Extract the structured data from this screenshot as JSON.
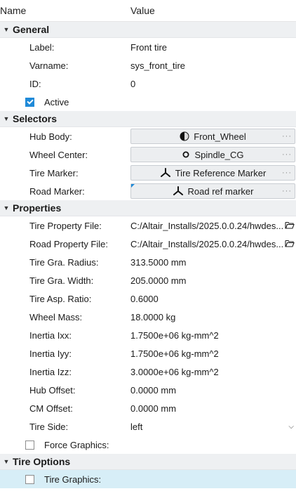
{
  "header": {
    "name_label": "Name",
    "value_label": "Value"
  },
  "sections": {
    "general": "General",
    "selectors": "Selectors",
    "properties": "Properties",
    "tire_options": "Tire Options"
  },
  "general": {
    "label": {
      "name": "Label:",
      "value": "Front tire"
    },
    "varname": {
      "name": "Varname:",
      "value": "sys_front_tire"
    },
    "id": {
      "name": "ID:",
      "value": "0"
    },
    "active": {
      "name": "Active",
      "checked": true
    }
  },
  "selectors": {
    "hub_body": {
      "name": "Hub Body:",
      "value": "Front_Wheel",
      "icon": "body-sphere-icon"
    },
    "wheel_center": {
      "name": "Wheel Center:",
      "value": "Spindle_CG",
      "icon": "point-icon"
    },
    "tire_marker": {
      "name": "Tire Marker:",
      "value": "Tire Reference Marker",
      "icon": "marker-icon"
    },
    "road_marker": {
      "name": "Road Marker:",
      "value": "Road ref marker",
      "icon": "marker-icon"
    }
  },
  "properties": {
    "tire_property_file": {
      "name": "Tire Property File:",
      "value": "C:/Altair_Installs/2025.0.0.24/hwdes..."
    },
    "road_property_file": {
      "name": "Road Property File:",
      "value": "C:/Altair_Installs/2025.0.0.24/hwdes..."
    },
    "tire_radius": {
      "name": "Tire Gra. Radius:",
      "value": "313.5000 mm"
    },
    "tire_width": {
      "name": "Tire Gra. Width:",
      "value": "205.0000 mm"
    },
    "tire_aspect": {
      "name": "Tire Asp. Ratio:",
      "value": "0.6000"
    },
    "wheel_mass": {
      "name": "Wheel Mass:",
      "value": "18.0000 kg"
    },
    "inertia_ixx": {
      "name": "Inertia Ixx:",
      "value": "1.7500e+06 kg-mm^2"
    },
    "inertia_iyy": {
      "name": "Inertia Iyy:",
      "value": "1.7500e+06 kg-mm^2"
    },
    "inertia_izz": {
      "name": "Inertia Izz:",
      "value": "3.0000e+06 kg-mm^2"
    },
    "hub_offset": {
      "name": "Hub Offset:",
      "value": "0.0000 mm"
    },
    "cm_offset": {
      "name": "CM Offset:",
      "value": "0.0000 mm"
    },
    "tire_side": {
      "name": "Tire Side:",
      "value": "left"
    },
    "force_graphics": {
      "name": "Force Graphics:",
      "checked": false
    }
  },
  "tire_options": {
    "tire_graphics": {
      "name": "Tire Graphics:",
      "checked": false
    }
  },
  "colors": {
    "accent": "#1f8ad8",
    "section_bg": "#eef0f2",
    "selected_row": "#d7eef7"
  }
}
